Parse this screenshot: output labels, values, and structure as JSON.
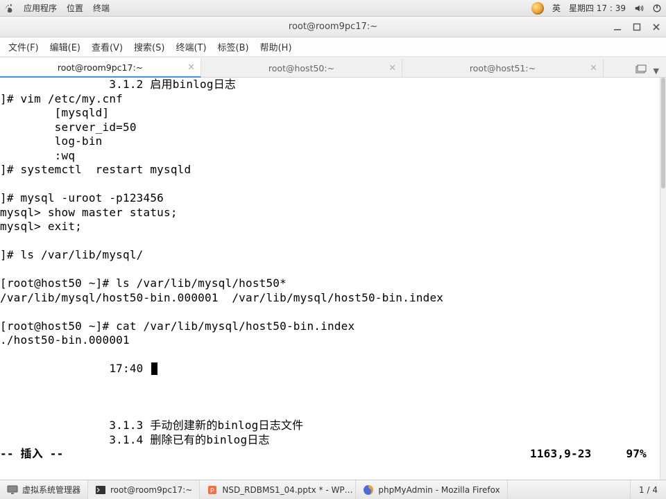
{
  "top_panel": {
    "apps": "应用程序",
    "places": "位置",
    "terminal": "终端",
    "ime": "英",
    "clock": "星期四 17 : 39"
  },
  "window": {
    "title": "root@room9pc17:~",
    "menus": {
      "file": "文件(F)",
      "edit": "编辑(E)",
      "view": "查看(V)",
      "search": "搜索(S)",
      "terminal": "终端(T)",
      "tabs": "标签(B)",
      "help": "帮助(H)"
    },
    "tabs": [
      {
        "label": "root@room9pc17:~",
        "active": true
      },
      {
        "label": "root@host50:~",
        "active": false
      },
      {
        "label": "root@host51:~",
        "active": false
      }
    ]
  },
  "terminal": {
    "lines": [
      "                3.1.2 启用binlog日志",
      "]# vim /etc/my.cnf",
      "        [mysqld]",
      "        server_id=50",
      "        log-bin",
      "        :wq",
      "]# systemctl  restart mysqld",
      "",
      "]# mysql -uroot -p123456",
      "mysql> show master status;",
      "mysql> exit;",
      "",
      "]# ls /var/lib/mysql/",
      "",
      "[root@host50 ~]# ls /var/lib/mysql/host50*",
      "/var/lib/mysql/host50-bin.000001  /var/lib/mysql/host50-bin.index",
      "",
      "[root@host50 ~]# cat /var/lib/mysql/host50-bin.index",
      "./host50-bin.000001",
      ""
    ],
    "time_line_prefix": "                17:40 ",
    "tail_lines": [
      "",
      "",
      "",
      "                3.1.3 手动创建新的binlog日志文件",
      "                3.1.4 删除已有的binlog日志"
    ],
    "status": {
      "mode": "-- 插入 --",
      "pos": "1163,9-23",
      "pct": "97%"
    }
  },
  "taskbar": {
    "vmm": "虚拟系统管理器",
    "term": "root@room9pc17:~",
    "wps": "NSD_RDBMS1_04.pptx * - WP…",
    "firefox": "phpMyAdmin - Mozilla Firefox",
    "workspace": "1 / 4"
  }
}
